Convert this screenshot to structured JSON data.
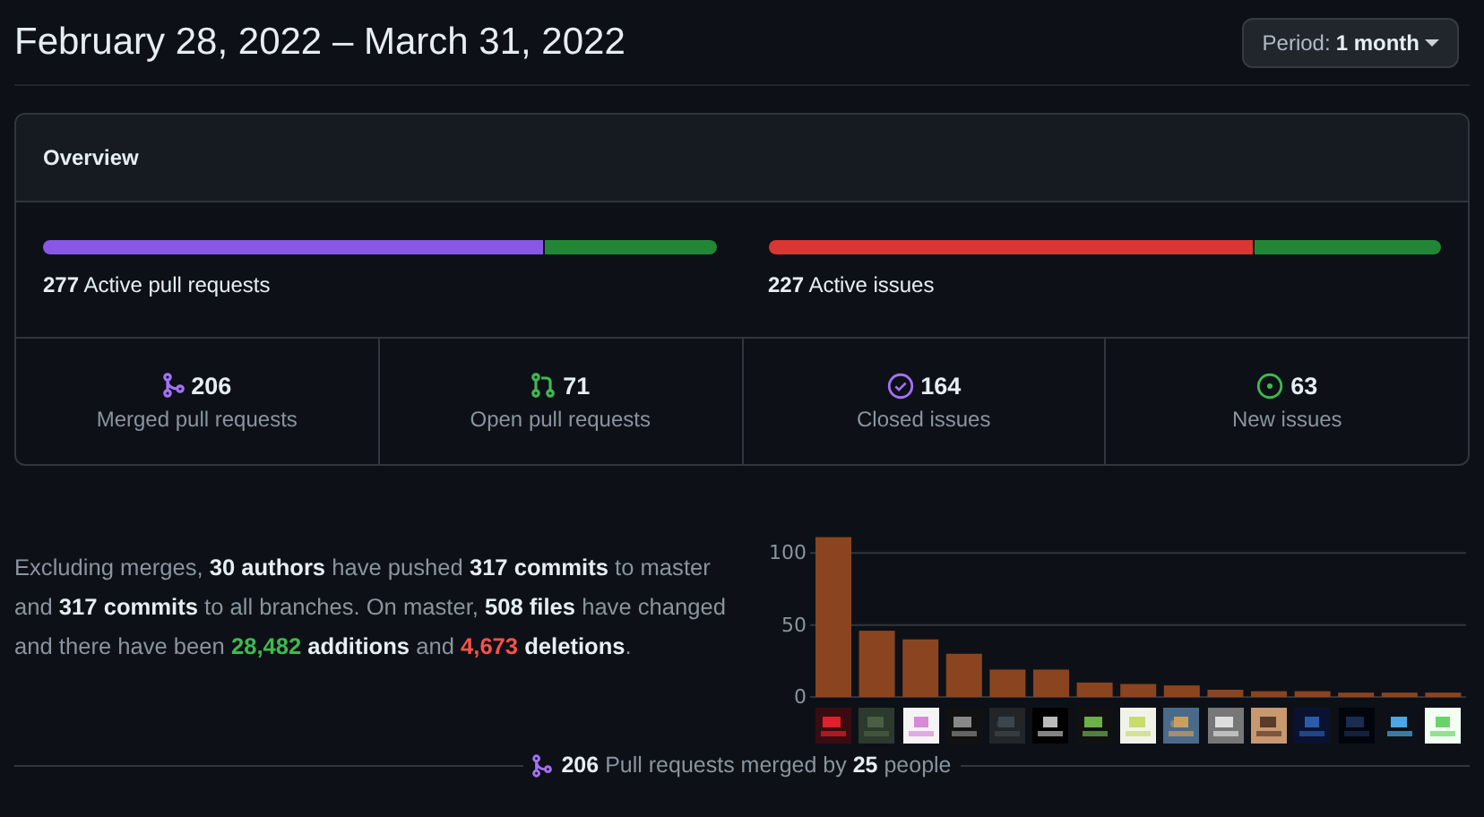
{
  "header": {
    "title": "February 28, 2022 – March 31, 2022",
    "period_label": "Period:",
    "period_value": "1 month"
  },
  "overview": {
    "title": "Overview",
    "bars": [
      {
        "label": "**277** Active pull requests",
        "segments": [
          {
            "color": "#8957e5",
            "level": 0.744
          },
          {
            "color": "#238636",
            "level": 0.256
          }
        ]
      },
      {
        "label": "**227** Active issues",
        "segments": [
          {
            "color": "#da3633",
            "level": 0.722
          },
          {
            "color": "#238636",
            "level": 0.278
          }
        ]
      }
    ],
    "stats": [
      {
        "kind": "merged",
        "value": "206",
        "label": "Merged pull requests"
      },
      {
        "kind": "open",
        "value": "71",
        "label": "Open pull requests"
      },
      {
        "kind": "closed",
        "value": "164",
        "label": "Closed issues"
      },
      {
        "kind": "new",
        "value": "63",
        "label": "New issues"
      }
    ]
  },
  "summary": [
    {
      "kind": "plain",
      "text": "Excluding merges, "
    },
    {
      "kind": "bold",
      "text": "30 authors"
    },
    {
      "kind": "plain",
      "text": " have pushed "
    },
    {
      "kind": "bold",
      "text": "317 commits"
    },
    {
      "kind": "plain",
      "text": " to master and "
    },
    {
      "kind": "bold",
      "text": "317 commits"
    },
    {
      "kind": "plain",
      "text": " to all branches. On master, "
    },
    {
      "kind": "bold",
      "text": "508 files"
    },
    {
      "kind": "plain",
      "text": " have changed and there have been "
    },
    {
      "kind": "added",
      "text": "28,482"
    },
    {
      "kind": "bold",
      "text": " additions"
    },
    {
      "kind": "plain",
      "text": " and "
    },
    {
      "kind": "deleted",
      "text": "4,673"
    },
    {
      "kind": "bold",
      "text": " deletions"
    },
    {
      "kind": "plain",
      "text": "."
    }
  ],
  "contributors": {
    "chart_data": {
      "type": "bar",
      "ylim": [
        0,
        112
      ],
      "yticks": [
        0,
        50,
        100
      ],
      "series": [
        {
          "color": "#8a4520",
          "values": [
            111,
            46,
            40,
            30,
            19,
            19,
            10,
            9,
            8,
            5,
            4,
            4,
            3,
            3,
            3
          ]
        }
      ]
    }
  },
  "merged_summary": "**206** Pull requests merged by **25** people"
}
